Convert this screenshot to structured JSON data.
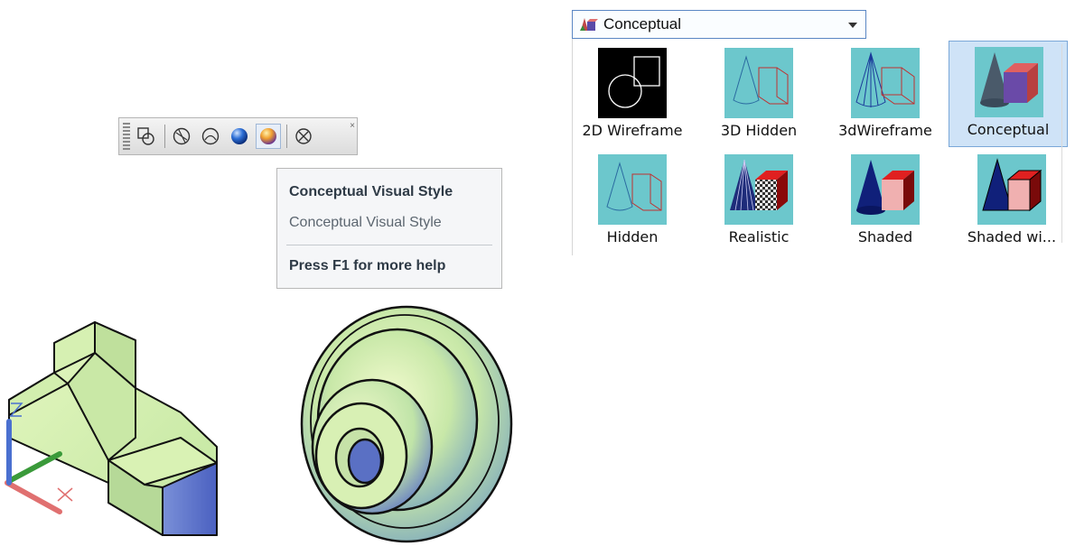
{
  "toolbar": {
    "buttons": [
      {
        "icon": "2d-wireframe-icon",
        "active": false
      },
      {
        "icon": "3d-wireframe-icon",
        "active": false
      },
      {
        "icon": "3d-hidden-icon",
        "active": false
      },
      {
        "icon": "realistic-sphere-icon",
        "active": false
      },
      {
        "icon": "conceptual-sphere-icon",
        "active": true
      },
      {
        "icon": "manage-visual-styles-icon",
        "active": false
      }
    ],
    "close_glyph": "×"
  },
  "tooltip": {
    "title": "Conceptual Visual Style",
    "description": "Conceptual Visual Style",
    "help": "Press F1 for more help"
  },
  "visual_styles": {
    "current": "Conceptual",
    "items": [
      {
        "label": "2D Wireframe"
      },
      {
        "label": "3D Hidden"
      },
      {
        "label": "3dWireframe"
      },
      {
        "label": "Conceptual",
        "selected": true
      },
      {
        "label": "Hidden"
      },
      {
        "label": "Realistic"
      },
      {
        "label": "Shaded"
      },
      {
        "label": "Shaded wi..."
      }
    ]
  },
  "colors": {
    "thumb_bg": "#6cc7cc",
    "model_fill": "#d8f0b0",
    "model_shadow": "#5a73c4",
    "axis_x": "#e07070",
    "axis_y": "#3a9a3a",
    "axis_z": "#4a70d0"
  }
}
